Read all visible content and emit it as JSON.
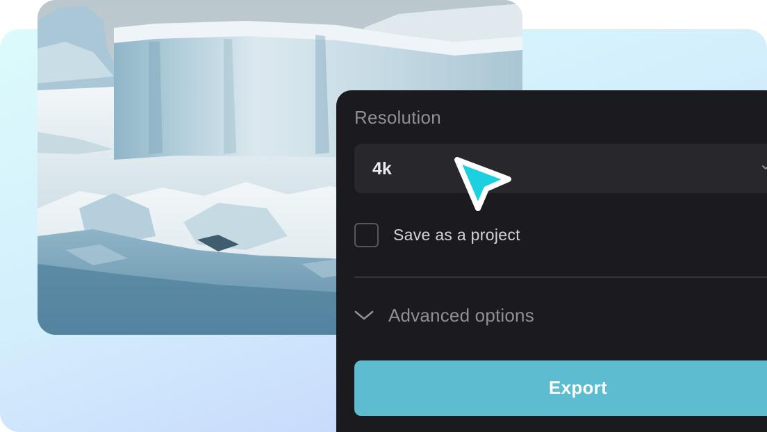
{
  "background_image": {
    "subject": "iceberg-photo"
  },
  "export_panel": {
    "resolution_label": "Resolution",
    "resolution_value": "4k",
    "save_project_label": "Save as a project",
    "save_project_checked": false,
    "advanced_options_label": "Advanced options",
    "export_button_label": "Export"
  },
  "colors": {
    "panel_background": "#1b1a1f",
    "select_background": "#27272c",
    "export_button": "#5dbcd0",
    "cursor": "#1dd0df"
  },
  "icons": {
    "resolution_caret": "chevron-down-icon",
    "advanced_toggle": "chevron-down-icon",
    "pointer": "cursor-arrow-icon"
  }
}
